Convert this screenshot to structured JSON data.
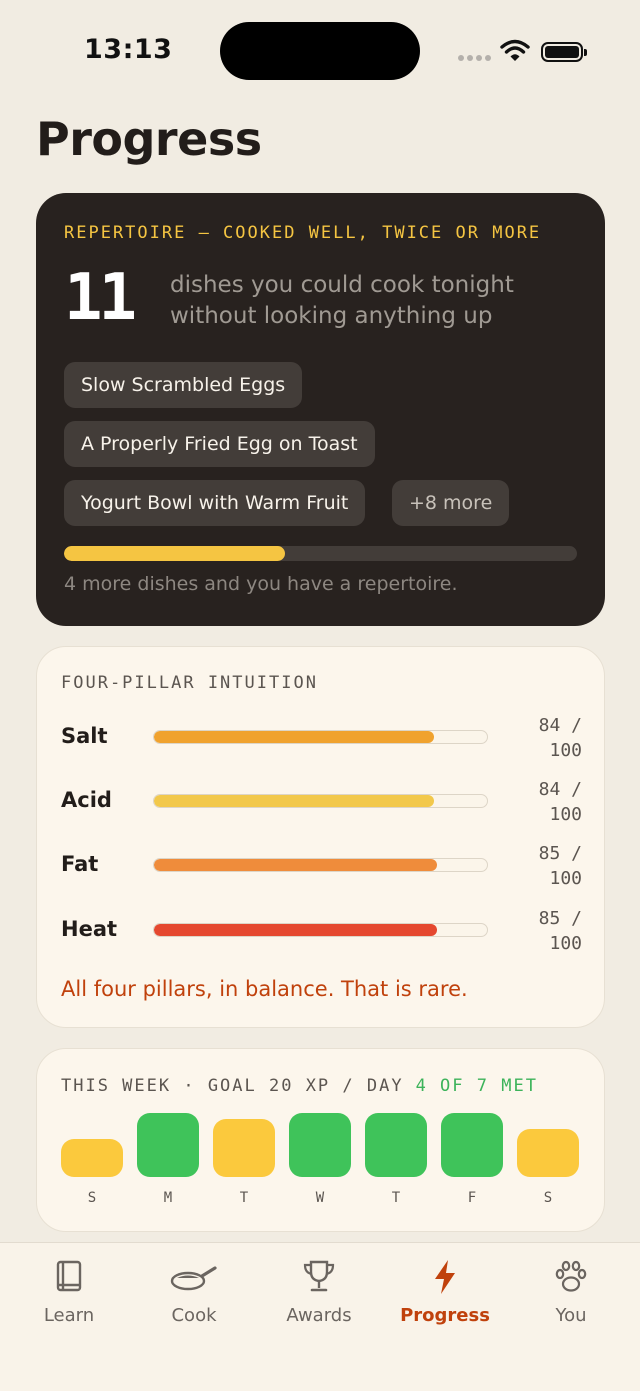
{
  "status_bar": {
    "time": "13:13"
  },
  "page": {
    "title": "Progress"
  },
  "repertoire": {
    "label": "REPERTOIRE — COOKED WELL, TWICE OR MORE",
    "count": "11",
    "description": "dishes you could cook tonight without looking anything up",
    "dishes": [
      "Slow Scrambled Eggs",
      "A Properly Fried Egg on Toast",
      "Yogurt Bowl with Warm Fruit"
    ],
    "more_label": "+8 more",
    "progress_fraction": 0.43,
    "note": "4 more dishes and you have a repertoire."
  },
  "pillars": {
    "label": "FOUR-PILLAR INTUITION",
    "items": [
      {
        "name": "Salt",
        "score": 84,
        "score_text": "84 / 100",
        "color": "#f0a22e"
      },
      {
        "name": "Acid",
        "score": 84,
        "score_text": "84 / 100",
        "color": "#f2c84b"
      },
      {
        "name": "Fat",
        "score": 85,
        "score_text": "85 / 100",
        "color": "#ef8c3b"
      },
      {
        "name": "Heat",
        "score": 85,
        "score_text": "85 / 100",
        "color": "#e5482f"
      }
    ],
    "message": "All four pillars, in balance. That is rare."
  },
  "week": {
    "label": "THIS WEEK · GOAL 20 XP / DAY",
    "met_label": "4 OF 7 MET",
    "days": [
      {
        "letter": "S",
        "met": false
      },
      {
        "letter": "M",
        "met": true
      },
      {
        "letter": "T",
        "met": false
      },
      {
        "letter": "W",
        "met": true
      },
      {
        "letter": "T",
        "met": true
      },
      {
        "letter": "F",
        "met": true
      },
      {
        "letter": "S",
        "met": false
      }
    ],
    "colors": {
      "met": "#3fc35a",
      "not_met": "#fbc93d"
    }
  },
  "tabs": [
    {
      "label": "Learn",
      "icon": "book-icon",
      "active": false
    },
    {
      "label": "Cook",
      "icon": "pan-icon",
      "active": false
    },
    {
      "label": "Awards",
      "icon": "trophy-icon",
      "active": false
    },
    {
      "label": "Progress",
      "icon": "bolt-icon",
      "active": true
    },
    {
      "label": "You",
      "icon": "paw-icon",
      "active": false
    }
  ],
  "colors": {
    "accent": "#c0410c",
    "highlight": "#f5c542"
  }
}
